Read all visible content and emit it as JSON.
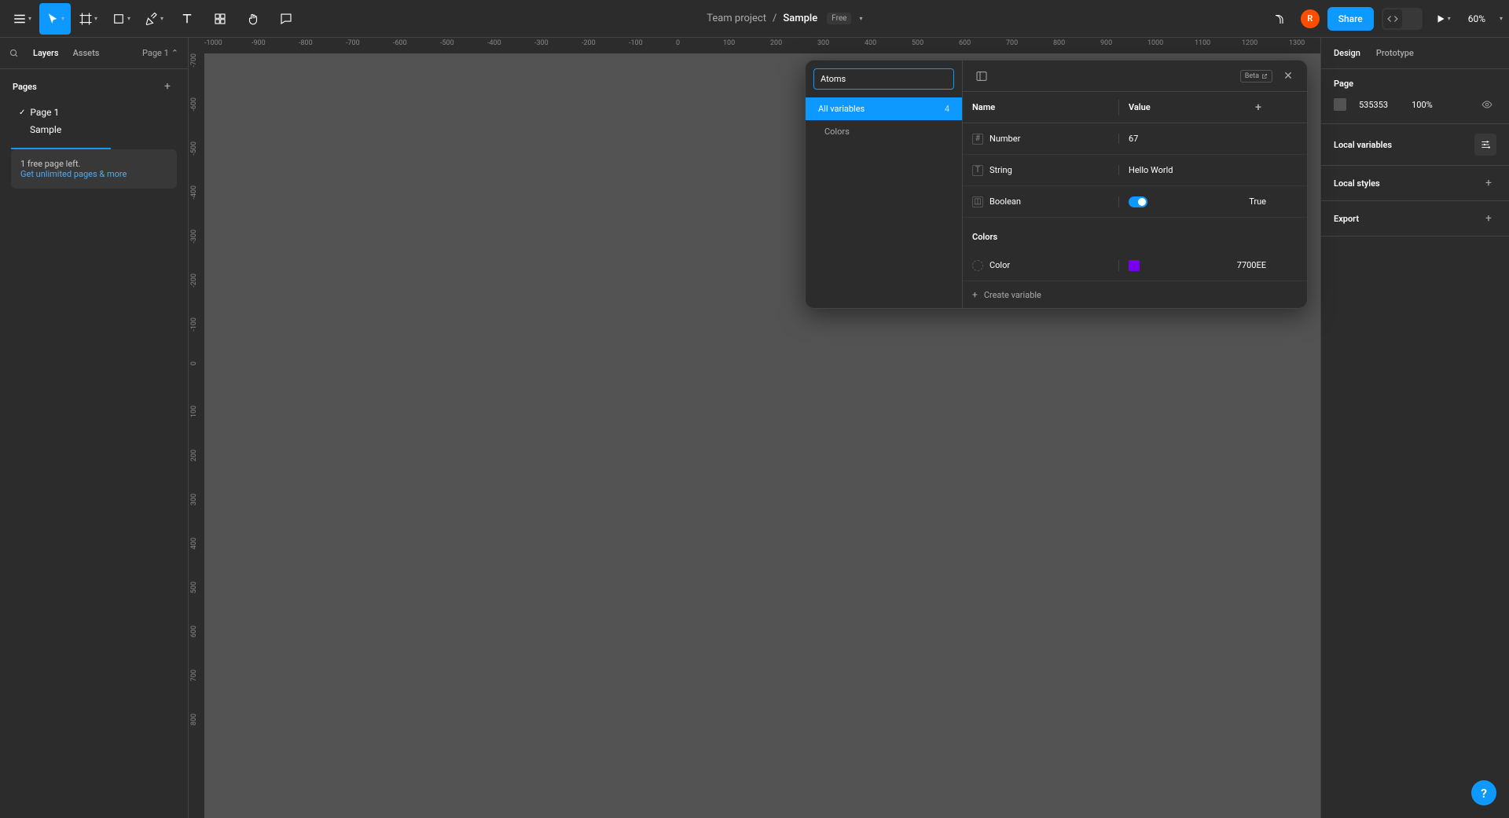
{
  "breadcrumb": {
    "project": "Team project",
    "doc": "Sample",
    "plan": "Free"
  },
  "share_label": "Share",
  "zoom": "60%",
  "avatar_initial": "R",
  "left_panel": {
    "tabs": {
      "layers": "Layers",
      "assets": "Assets"
    },
    "page_selector": "Page 1",
    "pages_label": "Pages",
    "pages": [
      {
        "name": "Page 1",
        "current": true
      },
      {
        "name": "Sample",
        "current": false
      }
    ],
    "upgrade": {
      "line1": "1 free page left.",
      "line2_link": "Get unlimited pages & more"
    }
  },
  "ruler_h": [
    "-1000",
    "-900",
    "-800",
    "-700",
    "-600",
    "-500",
    "-400",
    "-300",
    "-200",
    "-100",
    "0",
    "100",
    "200",
    "300",
    "400",
    "500",
    "600",
    "700",
    "800",
    "900",
    "1000",
    "1100",
    "1200",
    "1300"
  ],
  "ruler_v": [
    "-700",
    "-600",
    "-500",
    "-400",
    "-300",
    "-200",
    "-100",
    "0",
    "100",
    "200",
    "300",
    "400",
    "500",
    "600",
    "700",
    "800"
  ],
  "right_panel": {
    "tabs": {
      "design": "Design",
      "prototype": "Prototype"
    },
    "page_label": "Page",
    "bg_color": "535353",
    "bg_opacity": "100%",
    "local_variables_label": "Local variables",
    "local_styles_label": "Local styles",
    "export_label": "Export"
  },
  "variables_modal": {
    "search_value": "Atoms",
    "collections": [
      {
        "name": "All variables",
        "count": "4"
      }
    ],
    "groups_list": [
      "Colors"
    ],
    "beta_label": "Beta",
    "columns": {
      "name": "Name",
      "value": "Value"
    },
    "rows": [
      {
        "type": "number",
        "name": "Number",
        "value": "67"
      },
      {
        "type": "string",
        "name": "String",
        "value": "Hello World"
      },
      {
        "type": "boolean",
        "name": "Boolean",
        "value": "True"
      }
    ],
    "group_header": "Colors",
    "color_rows": [
      {
        "name": "Color",
        "hex": "7700EE",
        "swatch": "#7700EE"
      }
    ],
    "create_label": "Create variable"
  },
  "help_label": "?"
}
